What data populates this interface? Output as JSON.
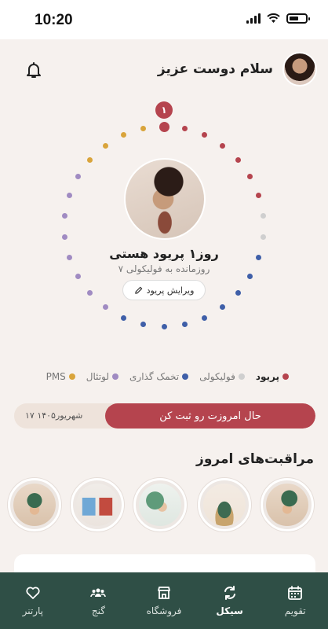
{
  "status_bar": {
    "time": "10:20"
  },
  "header": {
    "greeting": "سلام دوست عزیز"
  },
  "cycle": {
    "day_badge": "۱",
    "phase_title": "روز۱ پریود هستی",
    "phase_subtitle": "۷ روزمانده به فولیکولی",
    "edit_label": "ویرایش پریود"
  },
  "legend": [
    {
      "label": "پریود",
      "color": "#b5444e",
      "bold": true
    },
    {
      "label": "فولیکولی",
      "color": "#cfcfcf",
      "bold": false
    },
    {
      "label": "تخمک گذاری",
      "color": "#3f5fa8",
      "bold": false
    },
    {
      "label": "لوتئال",
      "color": "#a08bc2",
      "bold": false
    },
    {
      "label": "PMS",
      "color": "#d9a43b",
      "bold": false
    }
  ],
  "log": {
    "button_label": "حال امروزت رو ثبت کن",
    "date": "۱۷ شهریور۱۴۰۵"
  },
  "care_section": {
    "title": "مراقبت‌های امروز"
  },
  "care_cards": [
    {
      "icon": "woman-resting-icon"
    },
    {
      "icon": "woman-praying-icon"
    },
    {
      "icon": "woman-sleeping-icon"
    },
    {
      "icon": "jars-icon"
    },
    {
      "icon": "woman-tired-icon"
    }
  ],
  "bottom_nav": [
    {
      "label": "تقویم",
      "icon": "calendar-icon",
      "active": false
    },
    {
      "label": "سیکل",
      "icon": "cycle-icon",
      "active": true
    },
    {
      "label": "فروشگاه",
      "icon": "shop-icon",
      "active": false
    },
    {
      "label": "گنج",
      "icon": "community-icon",
      "active": false
    },
    {
      "label": "پارتنر",
      "icon": "heart-icon",
      "active": false
    }
  ],
  "colors": {
    "period": "#b5444e",
    "follicular": "#cfcfcf",
    "ovulation": "#3f5fa8",
    "luteal": "#a08bc2",
    "pms": "#d9a43b",
    "nav_bg": "#2f4f46"
  }
}
